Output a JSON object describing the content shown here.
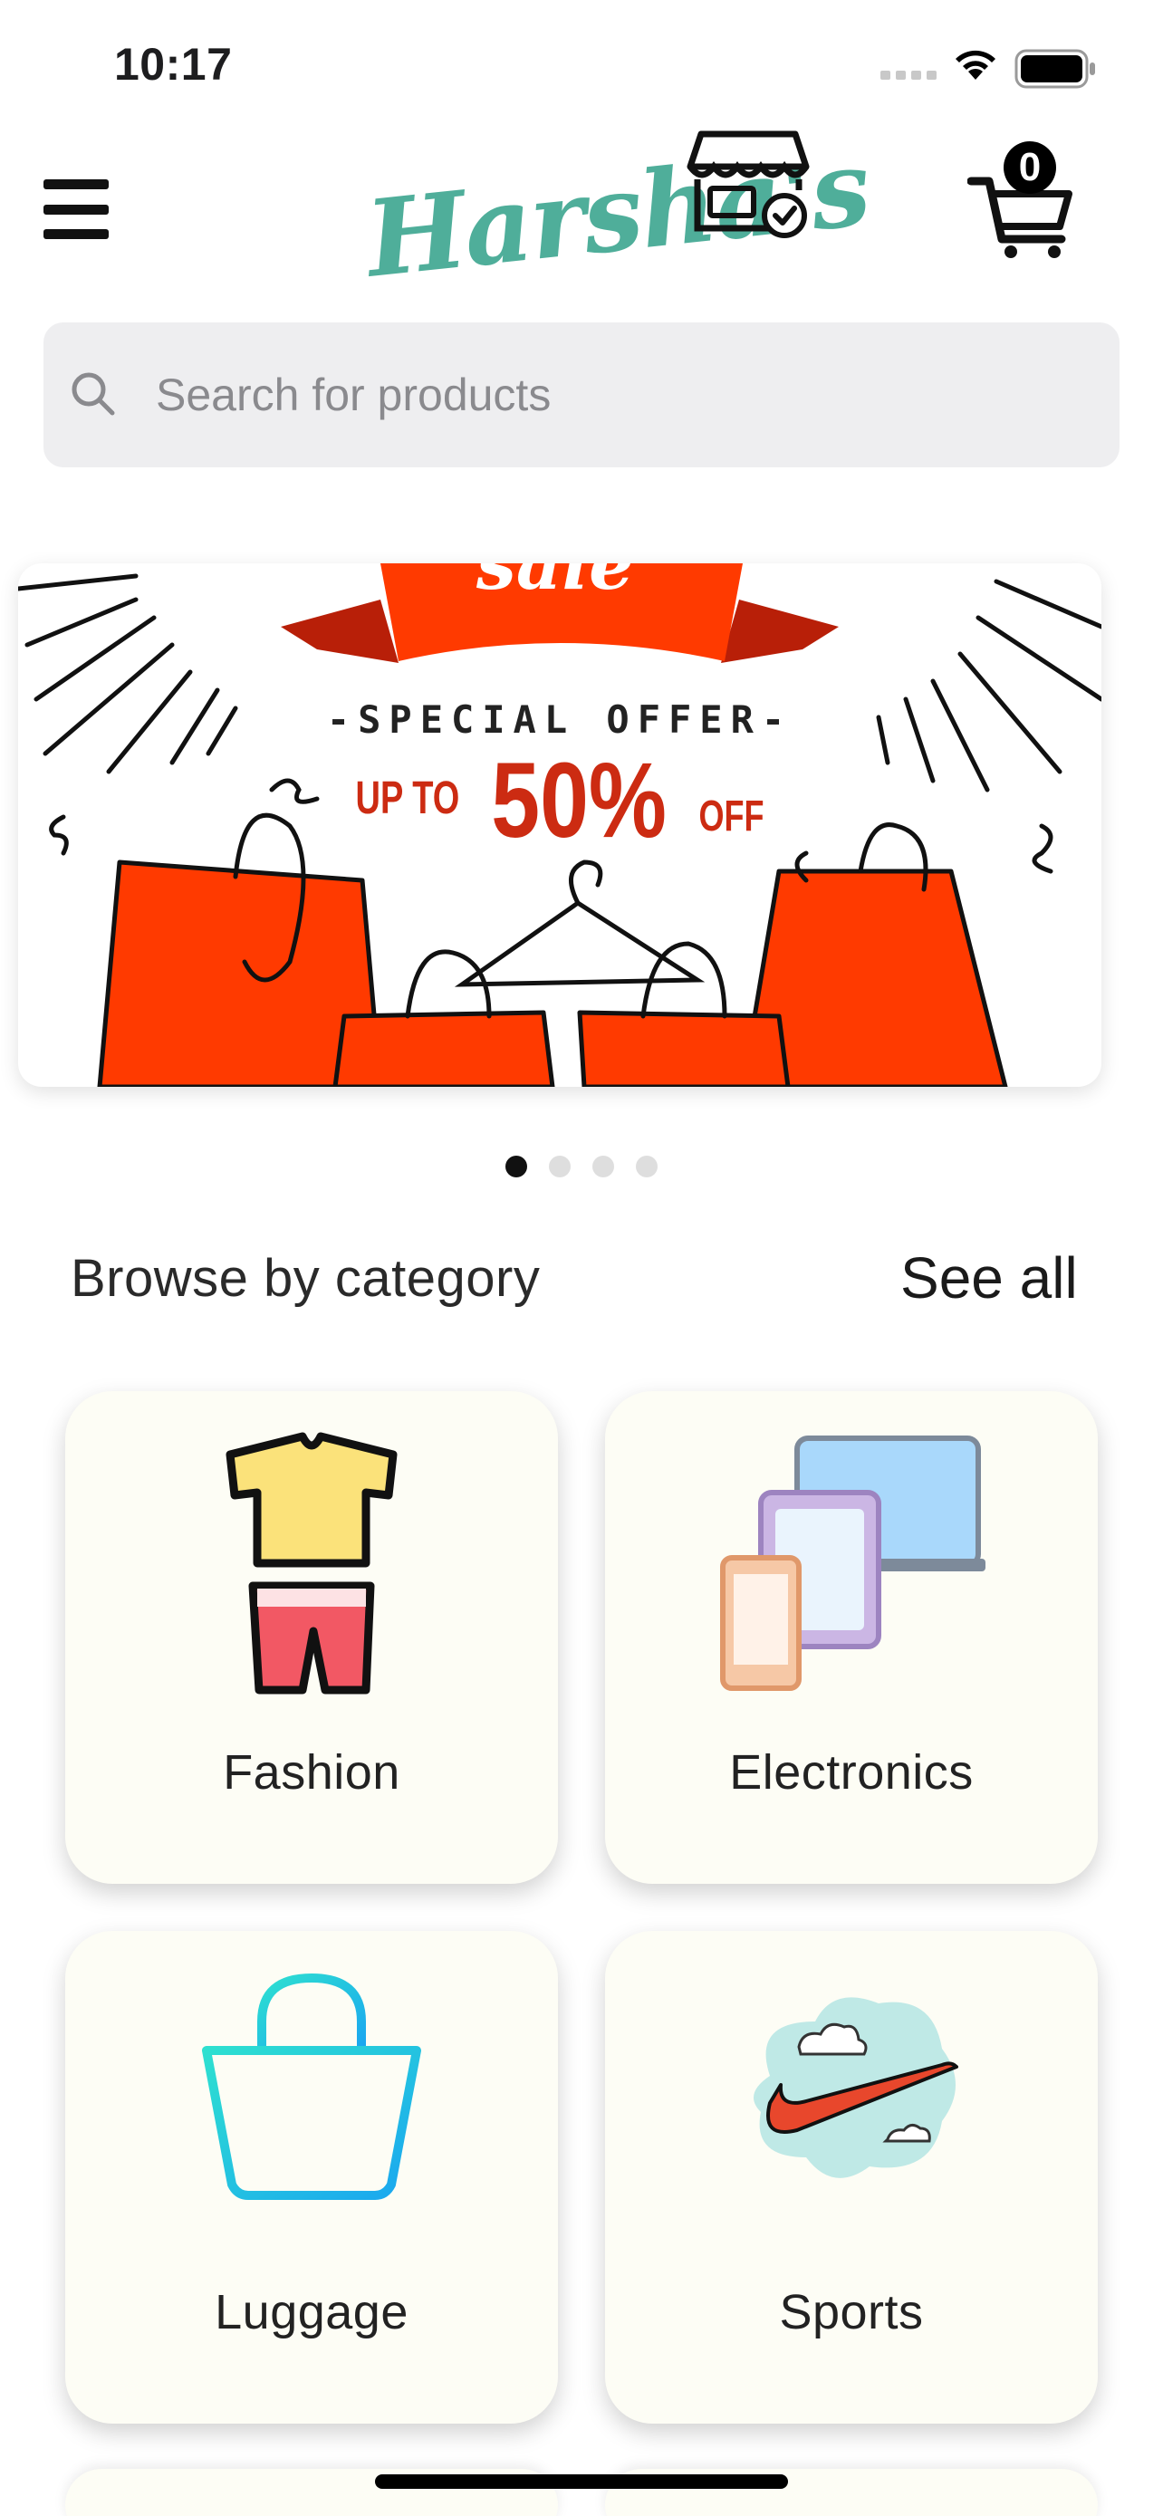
{
  "status_bar": {
    "time": "10:17"
  },
  "header": {
    "logo_text": "Harsha's",
    "cart_count": "0"
  },
  "search": {
    "placeholder": "Search for products"
  },
  "banner": {
    "sale_word": "sale",
    "headline": "-SPECIAL OFFER-",
    "up_to": "UP TO",
    "percent": "50%",
    "off": "OFF",
    "accent_color": "#ff3a00",
    "page_count": 4,
    "active_page": 1
  },
  "categories_section": {
    "title": "Browse by category",
    "see_all": "See all",
    "items": [
      {
        "label": "Fashion",
        "icon": "fashion-clothes-icon"
      },
      {
        "label": "Electronics",
        "icon": "electronics-devices-icon"
      },
      {
        "label": "Luggage",
        "icon": "luggage-bag-icon"
      },
      {
        "label": "Sports",
        "icon": "sports-swoosh-icon"
      }
    ]
  },
  "colors": {
    "brand_teal": "#4fae9a",
    "card_bg": "#fdfdf5",
    "search_bg": "#eeeef0"
  }
}
